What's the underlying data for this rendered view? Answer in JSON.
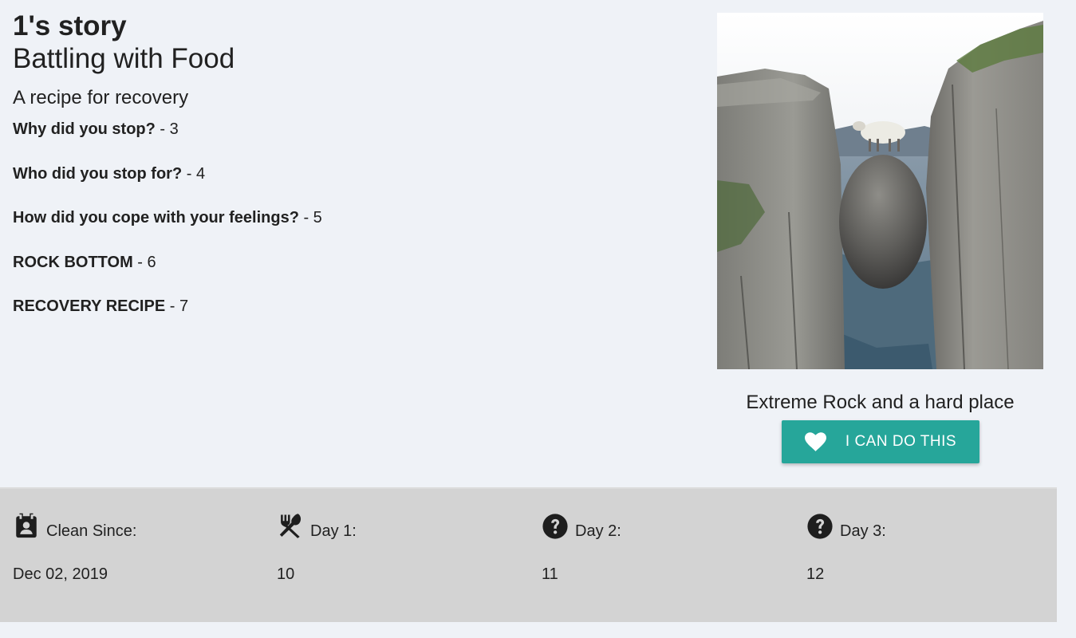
{
  "story": {
    "name": "1's story",
    "title": "Battling with Food",
    "subtitle": "A recipe for recovery",
    "items": [
      {
        "question": "Why did you stop?",
        "answer": " - 3"
      },
      {
        "question": "Who did you stop for?",
        "answer": " - 4"
      },
      {
        "question": "How did you cope with your feelings?",
        "answer": " - 5"
      },
      {
        "question": "ROCK BOTTOM",
        "answer": " - 6"
      },
      {
        "question": "RECOVERY RECIPE",
        "answer": " - 7"
      }
    ]
  },
  "image": {
    "caption": "Extreme Rock and a hard place",
    "alt": "Sheep standing on a boulder wedged between two cliffs"
  },
  "cta": {
    "label": "I CAN DO THIS",
    "icon": "heart-icon",
    "color": "#26a69a"
  },
  "stats": [
    {
      "icon": "calendar-contact-icon",
      "label": "Clean Since:",
      "value": "Dec 02, 2019"
    },
    {
      "icon": "utensils-icon",
      "label": "Day 1:",
      "value": "10"
    },
    {
      "icon": "question-circle-icon",
      "label": "Day 2:",
      "value": "11"
    },
    {
      "icon": "question-circle-icon",
      "label": "Day 3:",
      "value": "12"
    }
  ],
  "colors": {
    "page_background": "#eff2f7",
    "stats_background": "#d3d3d3",
    "text": "#212121"
  }
}
